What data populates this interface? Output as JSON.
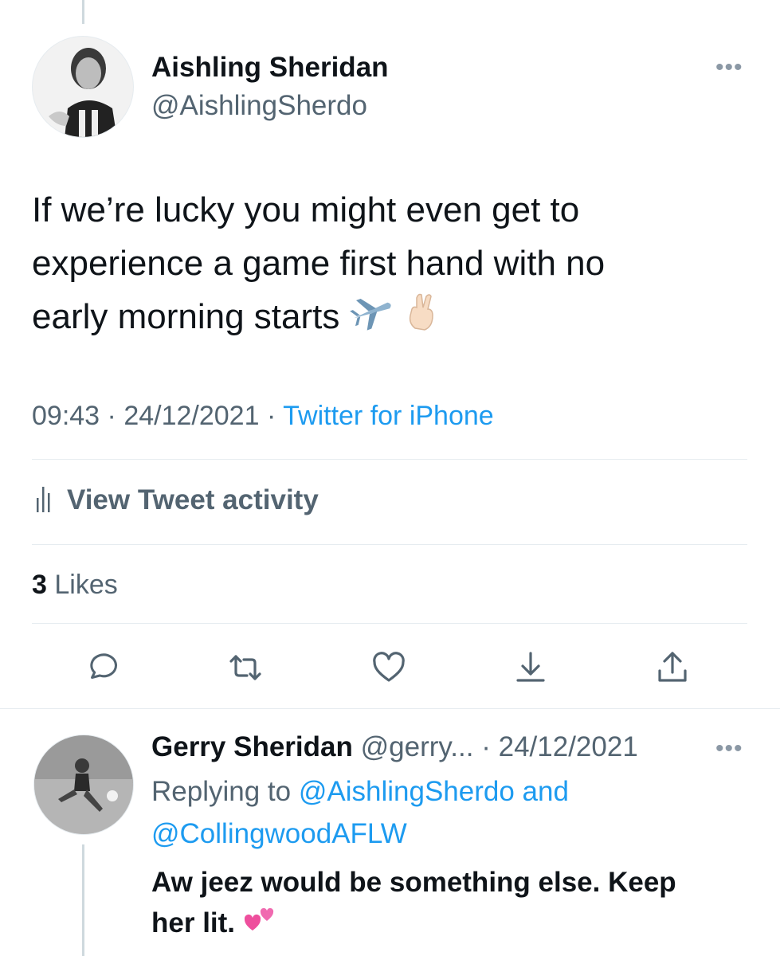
{
  "tweet": {
    "author_name": "Aishling Sheridan",
    "author_handle": "@AishlingSherdo",
    "text_lines": [
      "If we’re lucky you might even get to",
      "experience a game first hand with no",
      "early morning starts"
    ],
    "time": "09:43",
    "date": "24/12/2021",
    "separator": "·",
    "source": "Twitter for iPhone",
    "activity_label": "View Tweet activity",
    "likes_count": "3",
    "likes_label": "Likes",
    "emojis": [
      "airplane",
      "crossed-fingers"
    ]
  },
  "reply": {
    "author_name": "Gerry Sheridan",
    "author_handle": "@gerry...",
    "separator": "·",
    "date": "24/12/2021",
    "replying_prefix": "Replying to",
    "replying_to_1": "@AishlingSherdo",
    "replying_and": "and",
    "replying_to_2": "@CollingwoodAFLW",
    "text_line_1": "Aw jeez would be something else.  Keep",
    "text_line_2": "her lit.",
    "emoji": "two-hearts"
  },
  "icons": [
    "reply-icon",
    "retweet-icon",
    "like-icon",
    "bookmark-icon",
    "share-icon"
  ],
  "colors": {
    "link": "#1d9bf0",
    "secondary": "#536471",
    "divider": "#e6ecf0",
    "text": "#0f1419"
  }
}
